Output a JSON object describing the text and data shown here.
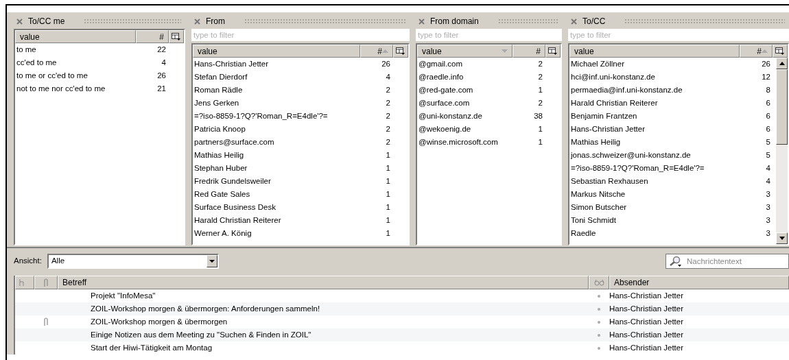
{
  "facets": [
    {
      "title": "To/CC me",
      "columns": [
        {
          "label": "value",
          "sort_up": false,
          "sort_down": false
        },
        {
          "label": "#",
          "sort_up": false,
          "sort_down": false
        }
      ],
      "rows": [
        {
          "value": "to me",
          "count": "22"
        },
        {
          "value": "cc'ed to me",
          "count": "4"
        },
        {
          "value": "to me or cc'ed to me",
          "count": "26"
        },
        {
          "value": "not to me nor cc'ed to me",
          "count": "21"
        }
      ]
    },
    {
      "title": "From",
      "filter": {
        "placeholder": "type to filter"
      },
      "columns": [
        {
          "label": "value",
          "sort_up": false,
          "sort_down": false
        },
        {
          "label": "#",
          "sort_up": true,
          "sort_down": false
        }
      ],
      "rows": [
        {
          "value": "Hans-Christian Jetter",
          "count": "26"
        },
        {
          "value": "Stefan Dierdorf",
          "count": "4"
        },
        {
          "value": "Roman Rädle",
          "count": "2"
        },
        {
          "value": "Jens Gerken",
          "count": "2"
        },
        {
          "value": "=?iso-8859-1?Q?'Roman_R=E4dle'?=",
          "count": "2"
        },
        {
          "value": "Patricia Knoop",
          "count": "2"
        },
        {
          "value": "partners@surface.com",
          "count": "2"
        },
        {
          "value": "Mathias Heilig",
          "count": "1"
        },
        {
          "value": "Stephan Huber",
          "count": "1"
        },
        {
          "value": "Fredrik Gundelsweiler",
          "count": "1"
        },
        {
          "value": "Red Gate Sales",
          "count": "1"
        },
        {
          "value": "Surface Business Desk",
          "count": "1"
        },
        {
          "value": "Harald Christian Reiterer",
          "count": "1"
        },
        {
          "value": "Werner A. König",
          "count": "1"
        }
      ]
    },
    {
      "title": "From domain",
      "filter": {
        "placeholder": "type to filter"
      },
      "columns": [
        {
          "label": "value",
          "sort_up": false,
          "sort_down": true
        },
        {
          "label": "#",
          "sort_up": false,
          "sort_down": false
        }
      ],
      "rows": [
        {
          "value": "@gmail.com",
          "count": "2"
        },
        {
          "value": "@raedle.info",
          "count": "2"
        },
        {
          "value": "@red-gate.com",
          "count": "1"
        },
        {
          "value": "@surface.com",
          "count": "2"
        },
        {
          "value": "@uni-konstanz.de",
          "count": "38"
        },
        {
          "value": "@wekoenig.de",
          "count": "1"
        },
        {
          "value": "@winse.microsoft.com",
          "count": "1"
        }
      ]
    },
    {
      "title": "To/CC",
      "filter": {
        "placeholder": "type to filter"
      },
      "columns": [
        {
          "label": "value",
          "sort_up": false,
          "sort_down": false
        },
        {
          "label": "#",
          "sort_up": true,
          "sort_down": false
        }
      ],
      "rows": [
        {
          "value": "Michael Zöllner",
          "count": "26"
        },
        {
          "value": "hci@inf.uni-konstanz.de",
          "count": "12"
        },
        {
          "value": "permaedia@inf.uni-konstanz.de",
          "count": "8"
        },
        {
          "value": "Harald Christian Reiterer",
          "count": "6"
        },
        {
          "value": "Benjamin Frantzen",
          "count": "6"
        },
        {
          "value": "Hans-Christian Jetter",
          "count": "6"
        },
        {
          "value": "Mathias Heilig",
          "count": "5"
        },
        {
          "value": "jonas.schweizer@uni-konstanz.de",
          "count": "5"
        },
        {
          "value": "=?iso-8859-1?Q?'Roman_R=E4dle'?=",
          "count": "4"
        },
        {
          "value": "Sebastian Rexhausen",
          "count": "4"
        },
        {
          "value": "Markus Nitsche",
          "count": "3"
        },
        {
          "value": "Simon Butscher",
          "count": "3"
        },
        {
          "value": "Toni Schmidt",
          "count": "3"
        },
        {
          "value": "Raedle",
          "count": "3"
        }
      ]
    }
  ],
  "view": {
    "label": "Ansicht:",
    "value": "Alle"
  },
  "search": {
    "placeholder": "Nachrichtentext"
  },
  "messages": {
    "columns": [
      "Betreff",
      "Absender"
    ],
    "rows": [
      {
        "subject": "Projekt \"InfoMesa\"",
        "attachment": false,
        "sender": "Hans-Christian Jetter"
      },
      {
        "subject": "ZOIL-Workshop morgen & übermorgen: Anforderungen sammeln!",
        "attachment": false,
        "sender": "Hans-Christian Jetter"
      },
      {
        "subject": "ZOIL-Workshop morgen & übermorgen",
        "attachment": true,
        "sender": "Hans-Christian Jetter"
      },
      {
        "subject": "Einige Notizen aus dem Meeting zu \"Suchen & Finden in ZOIL\"",
        "attachment": false,
        "sender": "Hans-Christian Jetter"
      },
      {
        "subject": "Start der Hiwi-Tätigkeit am Montag",
        "attachment": false,
        "sender": "Hans-Christian Jetter"
      }
    ]
  }
}
